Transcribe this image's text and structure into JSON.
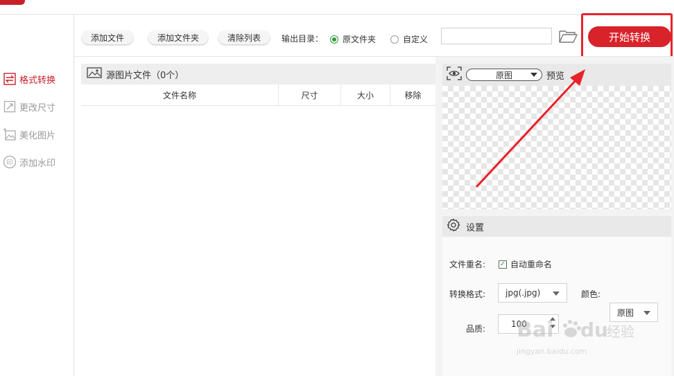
{
  "sidebar": {
    "items": [
      {
        "label": "格式转换",
        "icon": "swap-arrows-icon",
        "active": true
      },
      {
        "label": "更改尺寸",
        "icon": "resize-icon",
        "active": false
      },
      {
        "label": "美化图片",
        "icon": "beautify-image-icon",
        "active": false
      },
      {
        "label": "添加水印",
        "icon": "stamp-icon",
        "active": false
      }
    ]
  },
  "toolbar": {
    "add_file": "添加文件",
    "add_folder": "添加文件夹",
    "clear_list": "清除列表",
    "output_dir_label": "输出目录：",
    "option_original": "原文件夹",
    "option_custom": "自定义",
    "path_value": "",
    "start_label": "开始转换"
  },
  "file_panel": {
    "title": "源图片文件（0个）",
    "columns": [
      "文件名称",
      "尺寸",
      "大小",
      "移除"
    ],
    "rows": []
  },
  "preview": {
    "mode_value": "原图",
    "label": "预览"
  },
  "settings": {
    "title": "设置",
    "rename_label": "文件重名:",
    "auto_rename_label": "自动重命名",
    "auto_rename_checked": true,
    "format_label": "转换格式:",
    "format_value": "jpg(.jpg)",
    "color_label": "颜色:",
    "color_value": "原图",
    "quality_label": "品质:",
    "quality_value": "100"
  },
  "watermark": {
    "brand": "Bai du 经验",
    "url": "jingyan.baidu.com"
  },
  "colors": {
    "accent": "#d8232a",
    "radio_on": "#2a9d3a",
    "annotation": "#e8222a"
  }
}
